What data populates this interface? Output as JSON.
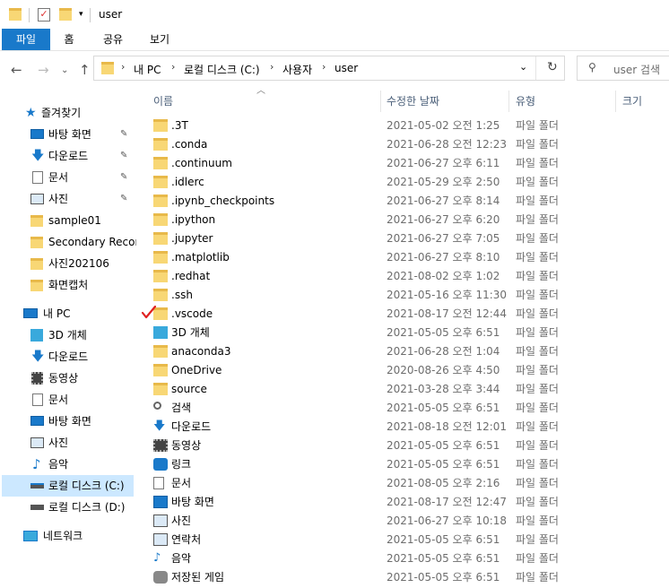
{
  "window": {
    "title": "user"
  },
  "ribbon": {
    "tabs": [
      "파일",
      "홈",
      "공유",
      "보기"
    ]
  },
  "address": {
    "crumbs": [
      "내 PC",
      "로컬 디스크 (C:)",
      "사용자",
      "user"
    ],
    "search_placeholder": "user 검색"
  },
  "nav": {
    "quick_access": "즐겨찾기",
    "pinned": [
      "바탕 화면",
      "다운로드",
      "문서",
      "사진"
    ],
    "folders": [
      "sample01",
      "Secondary Record",
      "사진202106",
      "화면캡처"
    ],
    "this_pc": "내 PC",
    "pc_items": [
      "3D 개체",
      "다운로드",
      "동영상",
      "문서",
      "바탕 화면",
      "사진",
      "음악",
      "로컬 디스크 (C:)",
      "로컬 디스크 (D:)"
    ],
    "network": "네트워크"
  },
  "columns": {
    "name": "이름",
    "modified": "수정한 날짜",
    "type": "유형",
    "size": "크기"
  },
  "files": [
    {
      "name": ".3T",
      "date": "2021-05-02 오전 1:25",
      "type": "파일 폴더",
      "icon": "folder-icon"
    },
    {
      "name": ".conda",
      "date": "2021-06-28 오전 12:23",
      "type": "파일 폴더",
      "icon": "folder-icon"
    },
    {
      "name": ".continuum",
      "date": "2021-06-27 오후 6:11",
      "type": "파일 폴더",
      "icon": "folder-icon"
    },
    {
      "name": ".idlerc",
      "date": "2021-05-29 오후 2:50",
      "type": "파일 폴더",
      "icon": "folder-icon"
    },
    {
      "name": ".ipynb_checkpoints",
      "date": "2021-06-27 오후 8:14",
      "type": "파일 폴더",
      "icon": "folder-icon"
    },
    {
      "name": ".ipython",
      "date": "2021-06-27 오후 6:20",
      "type": "파일 폴더",
      "icon": "folder-icon"
    },
    {
      "name": ".jupyter",
      "date": "2021-06-27 오후 7:05",
      "type": "파일 폴더",
      "icon": "folder-icon"
    },
    {
      "name": ".matplotlib",
      "date": "2021-06-27 오후 8:10",
      "type": "파일 폴더",
      "icon": "folder-icon"
    },
    {
      "name": ".redhat",
      "date": "2021-08-02 오후 1:02",
      "type": "파일 폴더",
      "icon": "folder-icon"
    },
    {
      "name": ".ssh",
      "date": "2021-05-16 오후 11:30",
      "type": "파일 폴더",
      "icon": "folder-icon"
    },
    {
      "name": ".vscode",
      "date": "2021-08-17 오전 12:44",
      "type": "파일 폴더",
      "icon": "folder-icon"
    },
    {
      "name": "3D 개체",
      "date": "2021-05-05 오후 6:51",
      "type": "파일 폴더",
      "icon": "3d-objects-icon"
    },
    {
      "name": "anaconda3",
      "date": "2021-06-28 오전 1:04",
      "type": "파일 폴더",
      "icon": "folder-icon"
    },
    {
      "name": "OneDrive",
      "date": "2020-08-26 오후 4:50",
      "type": "파일 폴더",
      "icon": "folder-icon"
    },
    {
      "name": "source",
      "date": "2021-03-28 오후 3:44",
      "type": "파일 폴더",
      "icon": "folder-icon"
    },
    {
      "name": "검색",
      "date": "2021-05-05 오후 6:51",
      "type": "파일 폴더",
      "icon": "search-icon"
    },
    {
      "name": "다운로드",
      "date": "2021-08-18 오전 12:01",
      "type": "파일 폴더",
      "icon": "download-icon"
    },
    {
      "name": "동영상",
      "date": "2021-05-05 오후 6:51",
      "type": "파일 폴더",
      "icon": "video-icon"
    },
    {
      "name": "링크",
      "date": "2021-05-05 오후 6:51",
      "type": "파일 폴더",
      "icon": "link-icon"
    },
    {
      "name": "문서",
      "date": "2021-08-05 오후 2:16",
      "type": "파일 폴더",
      "icon": "document-icon"
    },
    {
      "name": "바탕 화면",
      "date": "2021-08-17 오전 12:47",
      "type": "파일 폴더",
      "icon": "desktop-icon"
    },
    {
      "name": "사진",
      "date": "2021-06-27 오후 10:18",
      "type": "파일 폴더",
      "icon": "pictures-icon"
    },
    {
      "name": "연락처",
      "date": "2021-05-05 오후 6:51",
      "type": "파일 폴더",
      "icon": "contacts-icon"
    },
    {
      "name": "음악",
      "date": "2021-05-05 오후 6:51",
      "type": "파일 폴더",
      "icon": "music-icon"
    },
    {
      "name": "저장된 게임",
      "date": "2021-05-05 오후 6:51",
      "type": "파일 폴더",
      "icon": "saved-games-icon"
    }
  ],
  "colors": {
    "accent": "#1979ca",
    "selected": "#cce8ff",
    "folder": "#f8d775",
    "annotation_check": "#e02020"
  }
}
